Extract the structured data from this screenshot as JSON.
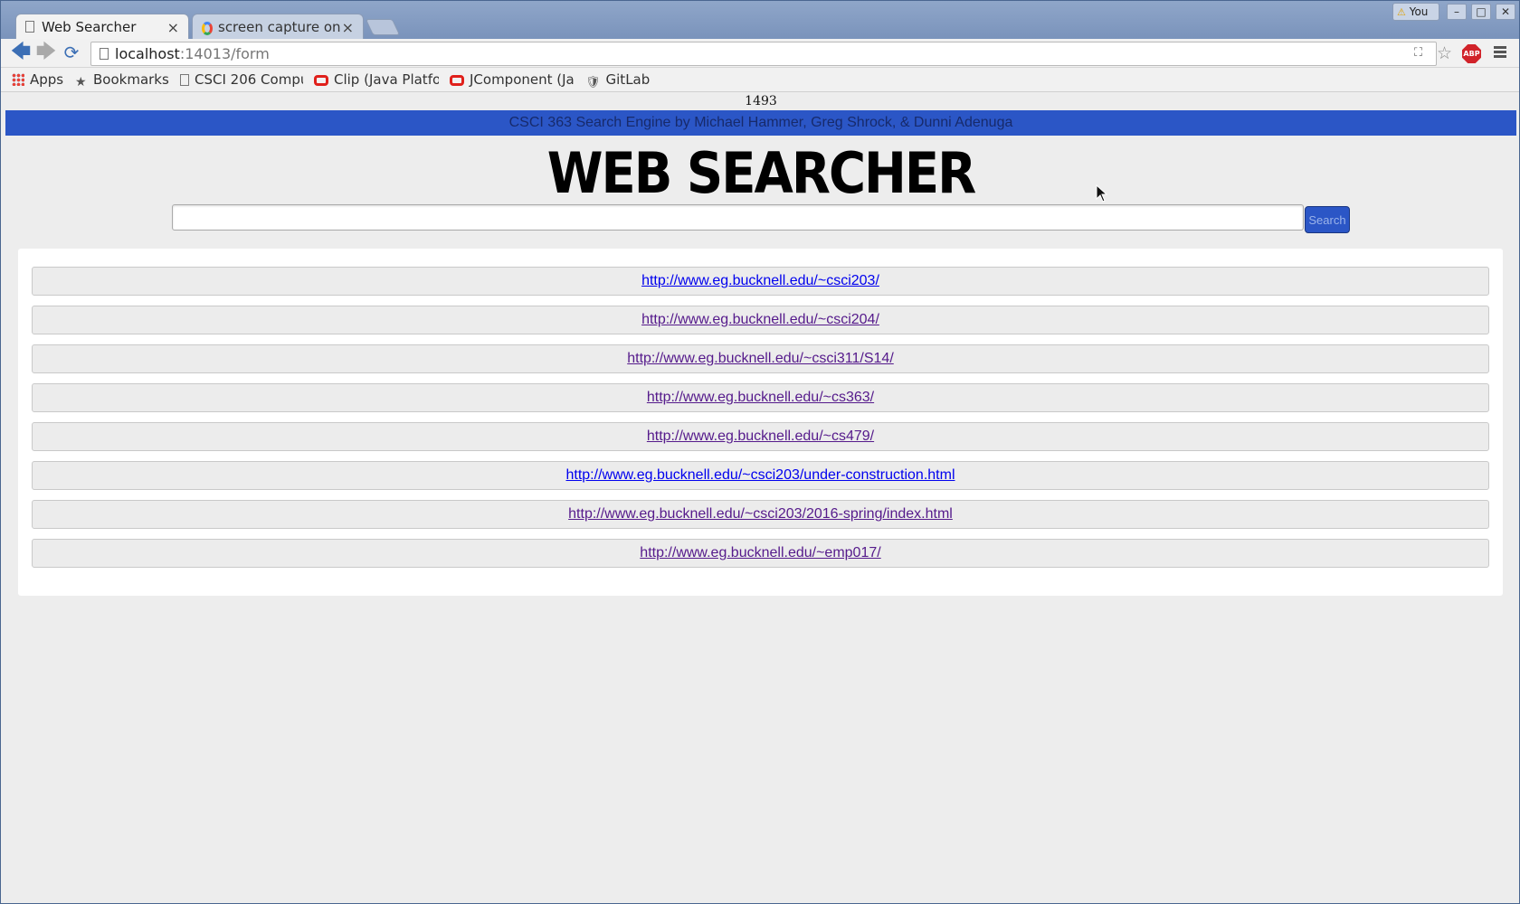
{
  "browser": {
    "tabs": [
      {
        "label": "Web Searcher",
        "active": true
      },
      {
        "label": "screen capture on l",
        "active": false
      }
    ],
    "profile_label": "You",
    "address": {
      "host": "localhost",
      "rest": ":14013/form"
    },
    "bookmarks": [
      {
        "label": "Apps",
        "icon": "apps-grid-icon"
      },
      {
        "label": "Bookmarks",
        "icon": "star-icon"
      },
      {
        "label": "CSCI 206 Compu",
        "icon": "page-icon"
      },
      {
        "label": "Clip (Java Platfo",
        "icon": "oracle-icon"
      },
      {
        "label": "JComponent (Ja",
        "icon": "oracle-icon"
      },
      {
        "label": "GitLab",
        "icon": "gitlab-icon"
      }
    ]
  },
  "page": {
    "counter": "1493",
    "banner": "CSCI 363 Search Engine by Michael Hammer, Greg Shrock, & Dunni Adenuga",
    "title": "WEB SEARCHER",
    "search": {
      "value": "",
      "button_label": "Search"
    },
    "results": [
      {
        "url": "http://www.eg.bucknell.edu/~csci203/",
        "visited": false
      },
      {
        "url": "http://www.eg.bucknell.edu/~csci204/",
        "visited": true
      },
      {
        "url": "http://www.eg.bucknell.edu/~csci311/S14/",
        "visited": true
      },
      {
        "url": "http://www.eg.bucknell.edu/~cs363/",
        "visited": true
      },
      {
        "url": "http://www.eg.bucknell.edu/~cs479/",
        "visited": true
      },
      {
        "url": "http://www.eg.bucknell.edu/~csci203/under-construction.html",
        "visited": false
      },
      {
        "url": "http://www.eg.bucknell.edu/~csci203/2016-spring/index.html",
        "visited": true
      },
      {
        "url": "http://www.eg.bucknell.edu/~emp017/",
        "visited": true
      }
    ]
  },
  "colors": {
    "banner": "#2b56c6",
    "link": "#0000ee",
    "visited_link": "#551a8b"
  }
}
